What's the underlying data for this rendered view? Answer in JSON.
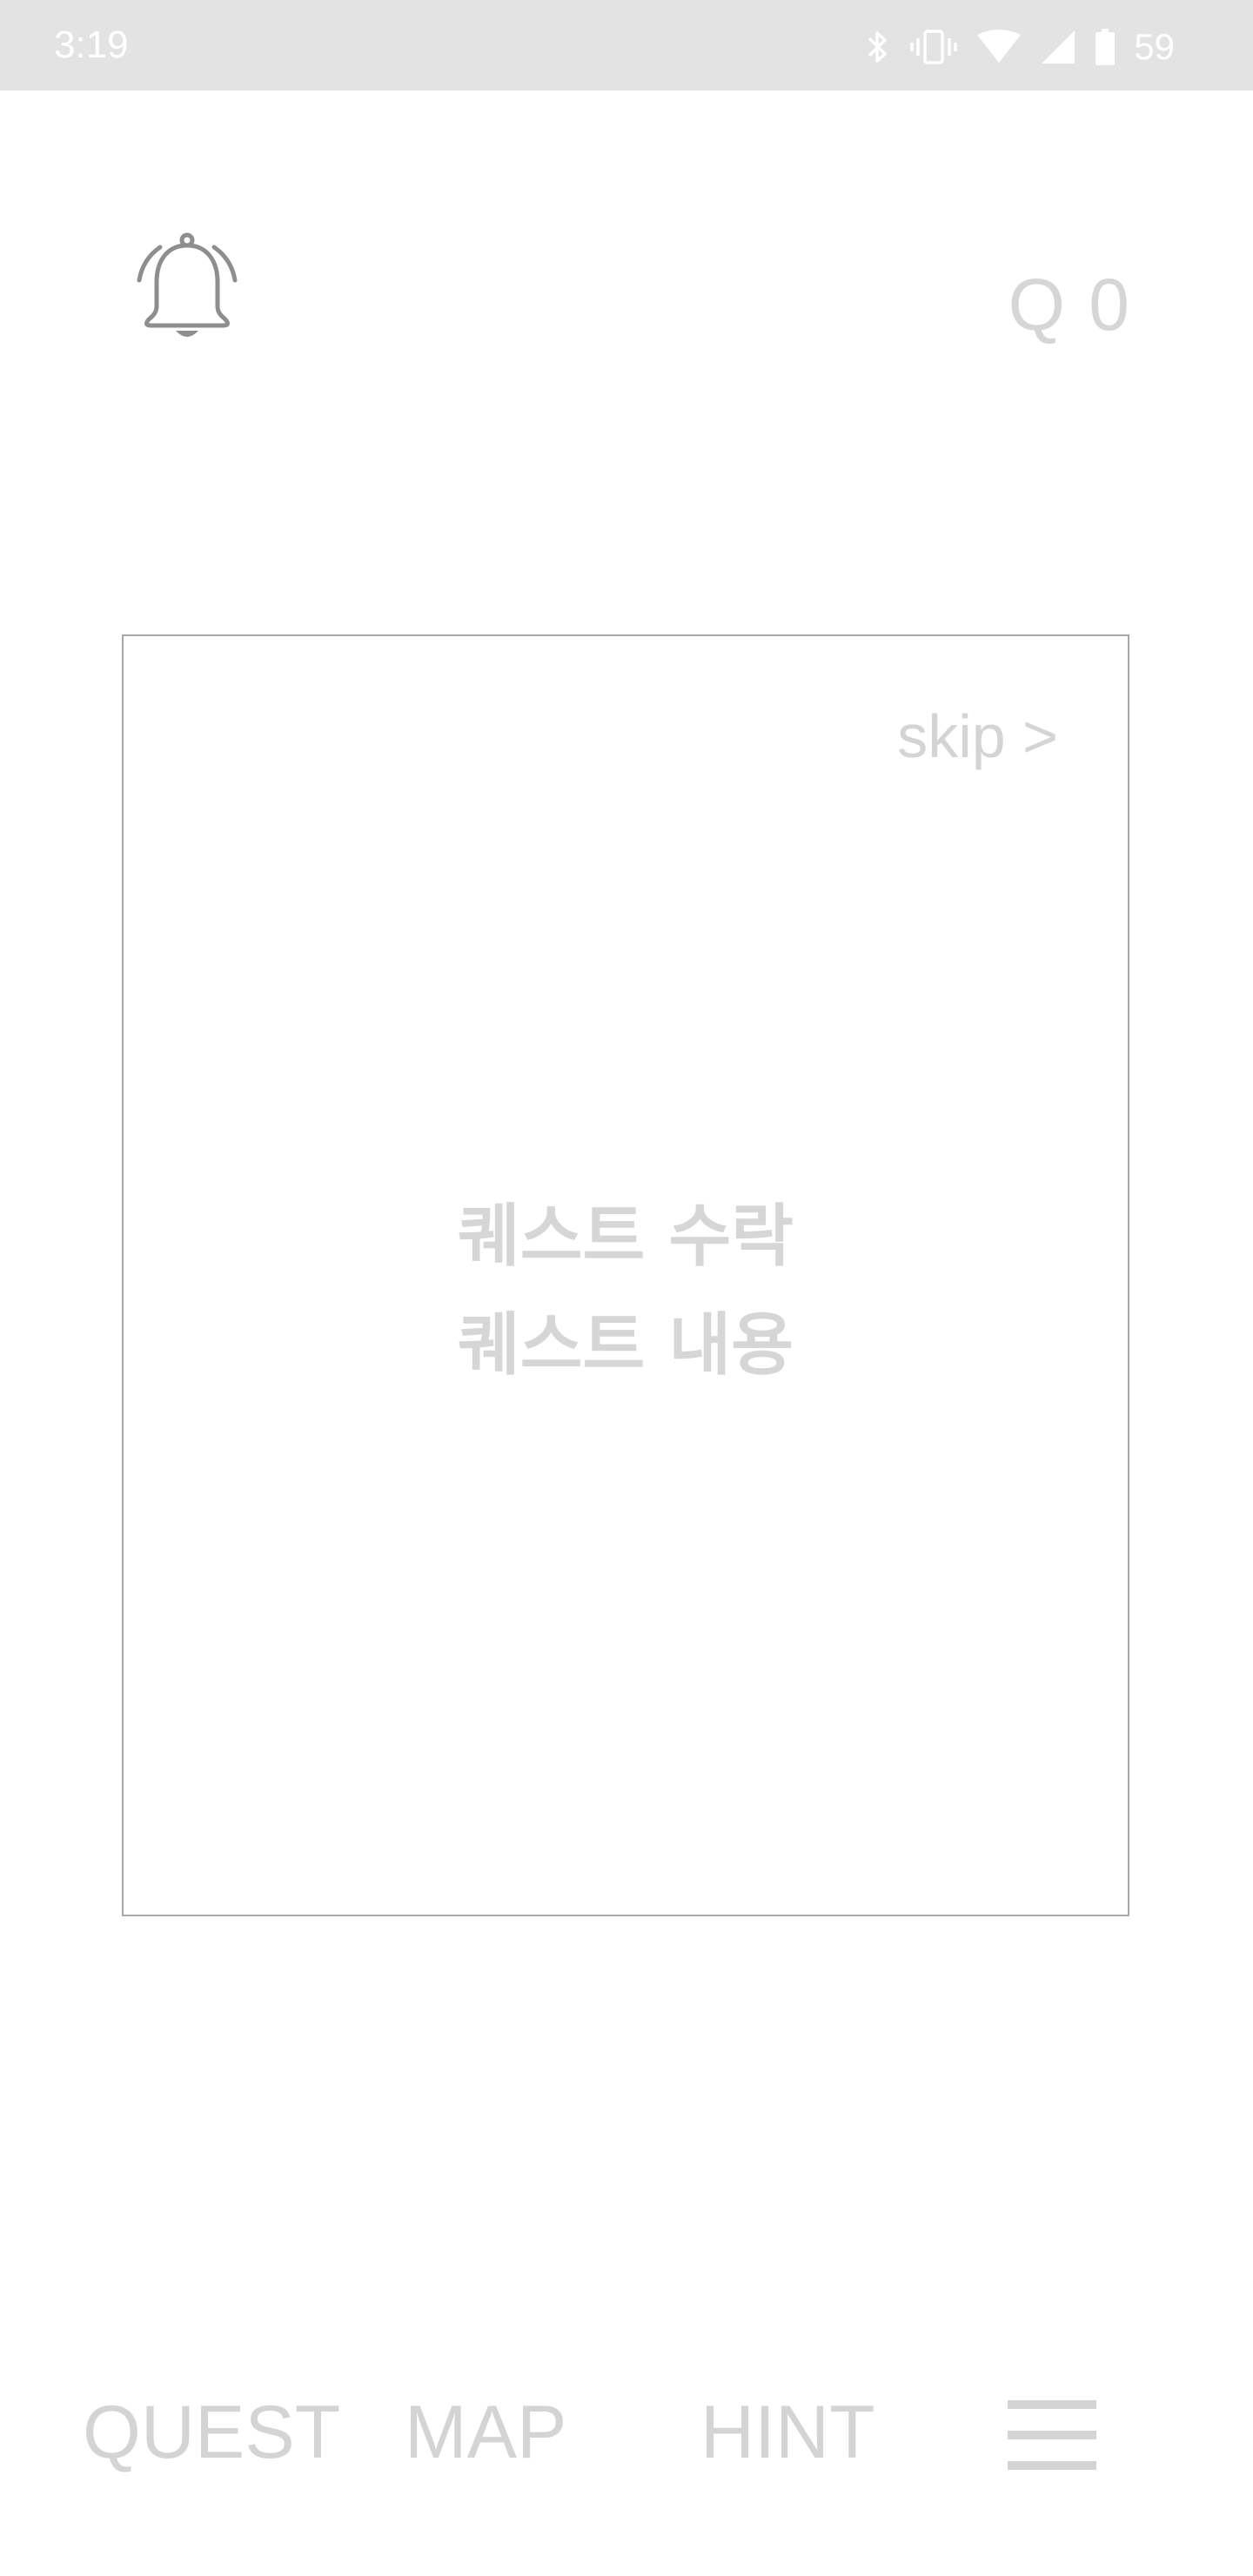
{
  "status_bar": {
    "time": "3:19",
    "battery": "59",
    "icons": [
      "bluetooth-icon",
      "vibrate-icon",
      "wifi-icon",
      "signal-icon",
      "battery-icon"
    ]
  },
  "header": {
    "bell_icon": "bell-icon",
    "q_counter": "Q 0"
  },
  "quest_card": {
    "skip_label": "skip >",
    "title": "퀘스트 수락",
    "content": "퀘스트 내용"
  },
  "bottom_nav": {
    "quest_label": "QUEST",
    "map_label": "MAP",
    "hint_label": "HINT",
    "menu_icon": "hamburger-menu-icon"
  },
  "colors": {
    "status_bar_bg": "#e3e3e3",
    "muted_text": "#d4d4d4",
    "bell_stroke": "#8e8e8e",
    "card_border": "#a9a9a9"
  }
}
